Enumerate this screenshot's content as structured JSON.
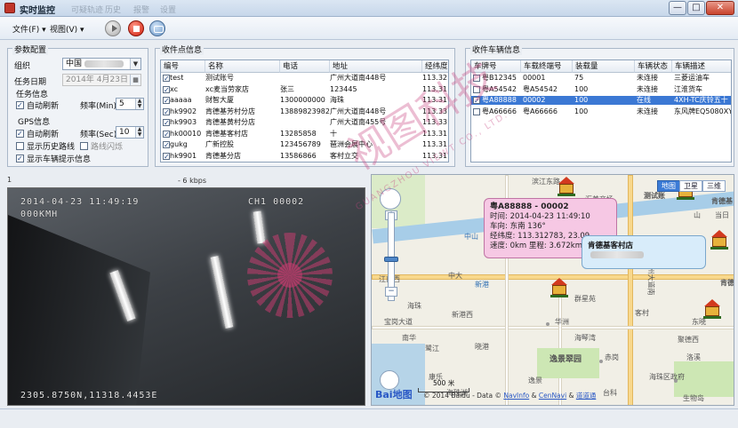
{
  "window": {
    "title": "实时监控",
    "ghost_tabs": [
      "可疑轨迹",
      "历史",
      "报警",
      "设置"
    ],
    "controls": {
      "minimize": "—",
      "maximize": "□",
      "close": "✕"
    }
  },
  "menu": {
    "file": "文件(F)",
    "view": "视图(V)"
  },
  "params": {
    "title": "参数配置",
    "org_label": "组织",
    "org_value": "中国",
    "date_label": "任务日期",
    "date_value": "2014年 4月23日",
    "task_title": "任务信息",
    "auto_refresh": "自动刷新",
    "freq_min_label": "频率(Min)",
    "freq_min_value": "5",
    "gps_title": "GPS信息",
    "gps_auto_refresh": "自动刷新",
    "freq_sec_label": "频率(Sec)",
    "freq_sec_value": "10",
    "show_history": "显示历史路线",
    "route_flash": "路线闪烁",
    "show_tip": "显示车辆提示信息"
  },
  "points": {
    "title": "收件点信息",
    "headers": [
      "编号",
      "名称",
      "电话",
      "地址",
      "经纬度"
    ],
    "rows": [
      [
        "test",
        "测试账号",
        "",
        "广州大道南448号",
        "113.32"
      ],
      [
        "xc",
        "xc麦当劳家店",
        "张三",
        "123445",
        "113.31"
      ],
      [
        "aaaaa",
        "财智大厦",
        "1300000000",
        "海珠",
        "113.31"
      ],
      [
        "hk9902",
        "肯德基芳村分店",
        "13889823982",
        "广州大道南448号",
        "113.33"
      ],
      [
        "hk9903",
        "肯德基黄村分店",
        "",
        "广州大道南455号",
        "113.33"
      ],
      [
        "hk00010",
        "肯德基客村店",
        "13285858",
        "十",
        "113.31"
      ],
      [
        "gukg",
        "广新控股",
        "123456789",
        "琶洲会展中心",
        "113.31"
      ],
      [
        "hk9901",
        "肯德基分店",
        "13586866",
        "客村立交",
        "113.31"
      ]
    ]
  },
  "vehicles": {
    "title": "收件车辆信息",
    "headers": [
      "车牌号",
      "车载终端号",
      "装载量",
      "车辆状态",
      "车辆描述"
    ],
    "rows": [
      [
        "粤B12345",
        "00001",
        "75",
        "未连接",
        "三菱运油车"
      ],
      [
        "粤A54542",
        "粤A54542",
        "100",
        "未连接",
        "江淮货车"
      ],
      [
        "粤A88888",
        "00002",
        "100",
        "在线",
        "4XH-TC庆铃五十"
      ],
      [
        "粤A66666",
        "粤A66666",
        "100",
        "未连接",
        "东风牌EQ5080XY"
      ]
    ]
  },
  "video": {
    "index": "1",
    "kbps": "- 6 kbps",
    "timestamp": "2014-04-23  11:49:19",
    "speed": "000KMH",
    "channel": "CH1  00002",
    "coords": "2305.8750N,11318.4453E"
  },
  "map": {
    "types": [
      "地图",
      "卫星",
      "三维"
    ],
    "popup": {
      "title": "粤A88888 - 00002",
      "time": "时间: 2014-04-23 11:49:10",
      "direction": "车向: 东南 136°",
      "lonlat": "经纬度: 113.312783, 23.09",
      "speed": "速度: 0km  里程: 3.672km"
    },
    "popup2": "肯德基客村店",
    "labels": {
      "zhongshan": "中山",
      "zhongda": "中大",
      "xingang": "新港",
      "jiangnan": "江南西",
      "yixue": "逸景翠园",
      "haizhu": "海珠区政府",
      "kecun": "客村",
      "kangle": "康乐",
      "huaguan": "华洲",
      "qunlan": "群星苑",
      "jujing": "聚德西",
      "luoxi": "海珠湖",
      "shengbo": "生物岛",
      "ceshi": "测试账",
      "kfc_r": "肯德基",
      "kfc_r2": "肯德基",
      "river_n": "滨江东路",
      "hz1": "海珠",
      "hz2": "宝岗大道",
      "hz3": "南华",
      "hz4": "新港西",
      "hz5": "晓港",
      "hz6": "广州大道南",
      "hz7": "赤岗",
      "hz8": "台科",
      "hz9": "汇美商场",
      "hz10": "当日",
      "hz11": "山",
      "hz12": "鹭江",
      "hz13": "吉",
      "hz14": "东晓",
      "hz15": "海琴湾",
      "hz16": "逸景",
      "hz17": "洛溪"
    },
    "scale": "500 米",
    "baidu": "Bai",
    "baidu2": "地图",
    "copyright_pre": "© 2014 Baidu - Data ©",
    "copyright_links": [
      "NavInfo",
      "&",
      "CenNavi",
      "&",
      "道道通"
    ]
  },
  "watermark": {
    "text": "视图科技",
    "sub": "GUANGZHOU VIEWT CO., LTD."
  }
}
